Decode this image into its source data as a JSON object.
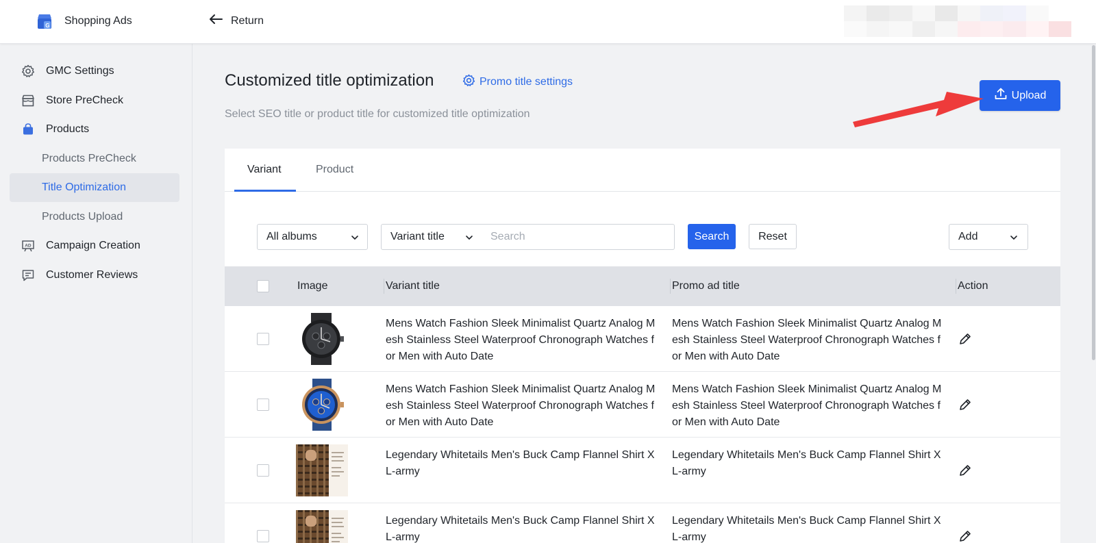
{
  "app": {
    "name": "Shopping Ads"
  },
  "header": {
    "return_label": "Return"
  },
  "sidebar": {
    "items": [
      {
        "label": "GMC Settings",
        "icon": "gear-icon"
      },
      {
        "label": "Store PreCheck",
        "icon": "store-icon"
      },
      {
        "label": "Products",
        "icon": "shopping-bag-icon"
      },
      {
        "label": "Products PreCheck"
      },
      {
        "label": "Title Optimization",
        "active": true
      },
      {
        "label": "Products Upload"
      },
      {
        "label": "Campaign Creation",
        "icon": "ad-board-icon"
      },
      {
        "label": "Customer Reviews",
        "icon": "review-icon"
      }
    ]
  },
  "page": {
    "title": "Customized title optimization",
    "promo_settings_label": "Promo title settings",
    "subtitle": "Select SEO title or product title for customized title optimization",
    "upload_label": "Upload"
  },
  "tabs": [
    {
      "label": "Variant",
      "active": true
    },
    {
      "label": "Product",
      "active": false
    }
  ],
  "filters": {
    "album_select": "All albums",
    "field_select": "Variant title",
    "search_placeholder": "Search",
    "search_label": "Search",
    "reset_label": "Reset",
    "add_select": "Add"
  },
  "table": {
    "columns": [
      "Image",
      "Variant title",
      "Promo ad title",
      "Action"
    ],
    "rows": [
      {
        "image": "black-watch",
        "variant_title": "Mens Watch Fashion Sleek Minimalist Quartz Analog Mesh Stainless Steel Waterproof Chronograph Watches for Men with Auto Date",
        "promo_title": "Mens Watch Fashion Sleek Minimalist Quartz Analog Mesh Stainless Steel Waterproof Chronograph Watches for Men with Auto Date"
      },
      {
        "image": "blue-gold-watch",
        "variant_title": "Mens Watch Fashion Sleek Minimalist Quartz Analog Mesh Stainless Steel Waterproof Chronograph Watches for Men with Auto Date",
        "promo_title": "Mens Watch Fashion Sleek Minimalist Quartz Analog Mesh Stainless Steel Waterproof Chronograph Watches for Men with Auto Date"
      },
      {
        "image": "flannel-shirt",
        "variant_title": "Legendary Whitetails Men's Buck Camp Flannel Shirt XL-army",
        "promo_title": "Legendary Whitetails Men's Buck Camp Flannel Shirt XL-army"
      },
      {
        "image": "flannel-shirt",
        "variant_title": "Legendary Whitetails Men's Buck Camp Flannel Shirt XL-army",
        "promo_title": "Legendary Whitetails Men's Buck Camp Flannel Shirt XL-army"
      }
    ]
  },
  "colors": {
    "primary": "#2563eb",
    "link": "#2e6be6",
    "annotation_arrow": "#ee3b3b"
  }
}
